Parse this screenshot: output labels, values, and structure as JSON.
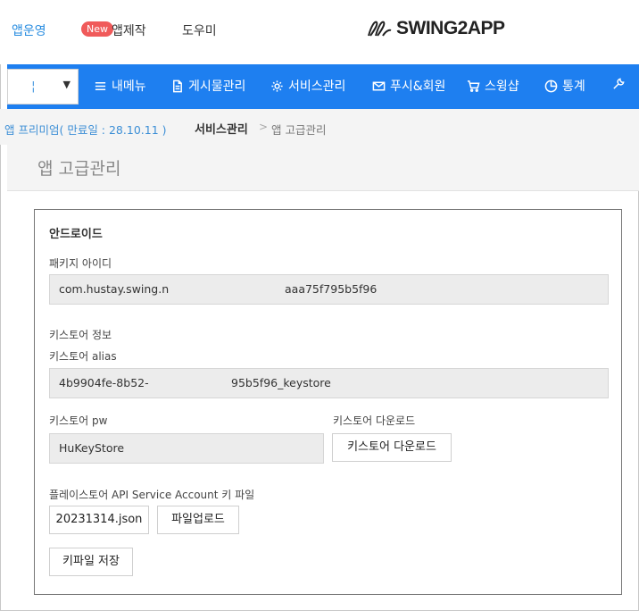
{
  "topbar": {
    "app_manage": "앱운영",
    "new_badge": "New",
    "app_make": "앱제작",
    "help": "도우미",
    "logo_text": "SWING2APP"
  },
  "navbar": {
    "select_caret": "▼",
    "items": [
      {
        "label": "내메뉴",
        "icon": "menu-icon"
      },
      {
        "label": "게시물관리",
        "icon": "document-icon"
      },
      {
        "label": "서비스관리",
        "icon": "gear-icon"
      },
      {
        "label": "푸시&회원",
        "icon": "mail-icon"
      },
      {
        "label": "스윙샵",
        "icon": "cart-icon"
      },
      {
        "label": "통계",
        "icon": "pie-chart-icon"
      }
    ],
    "accent": "#1e7ff0"
  },
  "breadcrumb": {
    "premium_info": "앱 프리미엄( 만료일 : 28.10.11 )",
    "level1": "서비스관리",
    "separator": ">",
    "level2": "앱 고급관리"
  },
  "page": {
    "title": "앱 고급관리"
  },
  "android": {
    "section_title": "안드로이드",
    "package_label": "패키지 아이디",
    "package_value_left": "com.hustay.swing.n",
    "package_value_right": "aaa75f795b5f96",
    "keystore_info_label": "키스토어 정보",
    "alias_label": "키스토어 alias",
    "alias_value_left": "4b9904fe-8b52-",
    "alias_value_right": "95b5f96_keystore",
    "pw_label": "키스토어 pw",
    "pw_value": "HuKeyStore",
    "download_label": "키스토어 다운로드",
    "download_button": "키스토어 다운로드",
    "playstore_key_label": "플레이스토어 API Service Account 키 파일",
    "key_file_name": "20231314.json",
    "upload_button": "파일업로드",
    "save_button": "키파일 저장"
  }
}
